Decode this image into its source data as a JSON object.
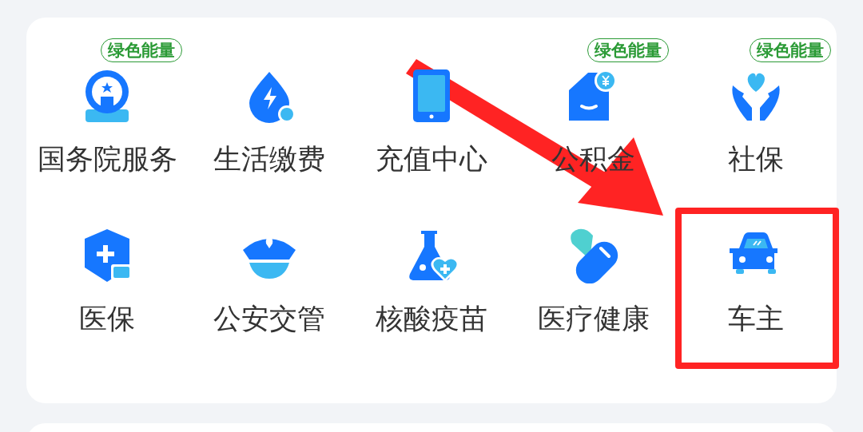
{
  "services": [
    {
      "label": "国务院服务",
      "badge": "绿色能量",
      "highlighted": false
    },
    {
      "label": "生活缴费",
      "highlighted": false
    },
    {
      "label": "充值中心",
      "highlighted": false
    },
    {
      "label": "公积金",
      "badge": "绿色能量",
      "highlighted": false
    },
    {
      "label": "社保",
      "badge": "绿色能量",
      "highlighted": false
    },
    {
      "label": "医保",
      "highlighted": false
    },
    {
      "label": "公安交管",
      "highlighted": false
    },
    {
      "label": "核酸疫苗",
      "highlighted": false
    },
    {
      "label": "医疗健康",
      "highlighted": false
    },
    {
      "label": "车主",
      "highlighted": true
    }
  ]
}
